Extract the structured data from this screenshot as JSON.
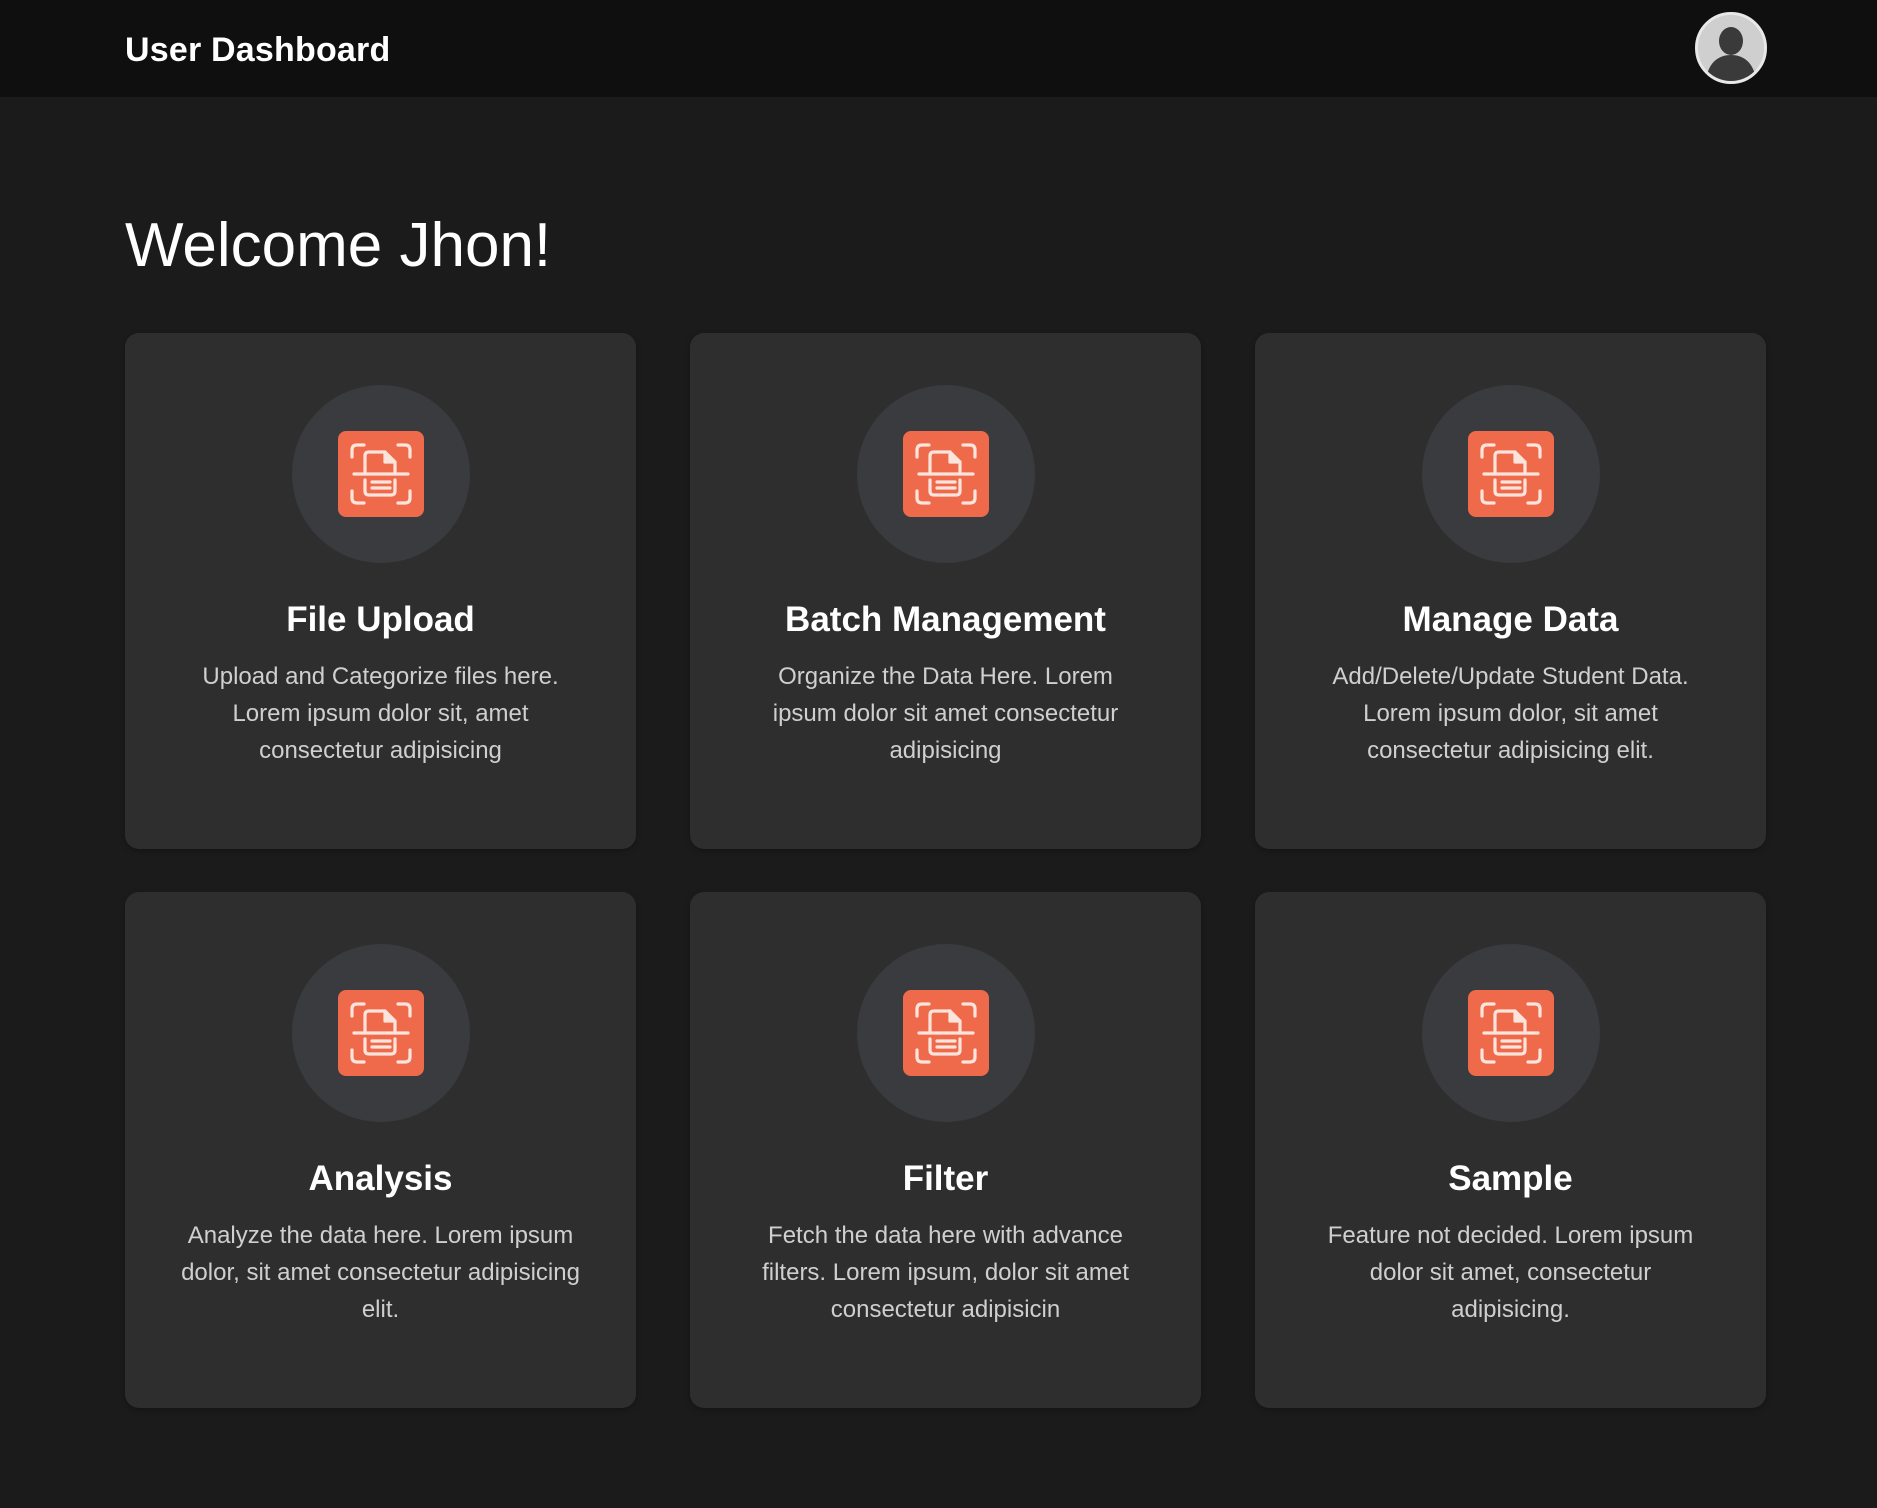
{
  "header": {
    "title": "User Dashboard",
    "avatar_icon": "user-avatar-icon"
  },
  "welcome": {
    "text": "Welcome Jhon!"
  },
  "theme": {
    "accent": "#ef6a4b",
    "background": "#1b1b1b",
    "card": "#2e2e2e",
    "topbar": "#0f0f0f"
  },
  "cards": [
    {
      "title": "File Upload",
      "description": "Upload and Categorize files here. Lorem ipsum dolor sit, amet consectetur adipisicing",
      "icon": "document-scan-icon"
    },
    {
      "title": "Batch Management",
      "description": "Organize the Data Here. Lorem ipsum dolor sit amet consectetur adipisicing",
      "icon": "document-scan-icon"
    },
    {
      "title": "Manage Data",
      "description": "Add/Delete/Update Student Data. Lorem ipsum dolor, sit amet consectetur adipisicing elit.",
      "icon": "document-scan-icon"
    },
    {
      "title": "Analysis",
      "description": "Analyze the data here. Lorem ipsum dolor, sit amet consectetur adipisicing elit.",
      "icon": "document-scan-icon"
    },
    {
      "title": "Filter",
      "description": "Fetch the data here with advance filters. Lorem ipsum, dolor sit amet consectetur adipisicin",
      "icon": "document-scan-icon"
    },
    {
      "title": "Sample",
      "description": "Feature not decided. Lorem ipsum dolor sit amet, consectetur adipisicing.",
      "icon": "document-scan-icon"
    }
  ]
}
